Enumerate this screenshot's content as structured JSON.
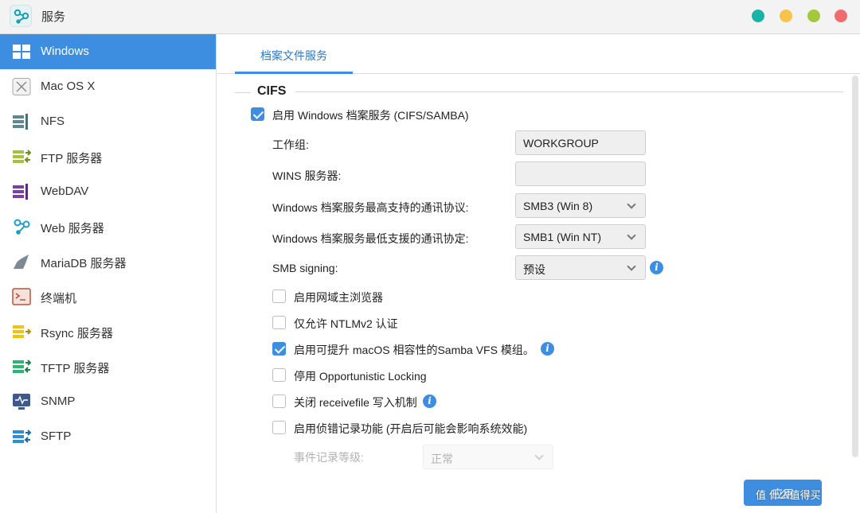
{
  "window": {
    "title": "服务",
    "colors": {
      "accent": "#3d8de0",
      "btn_teal": "#1ab3a8",
      "btn_yellow": "#f8c34a",
      "btn_green": "#a3c83a",
      "btn_red": "#f06b6b"
    }
  },
  "sidebar": {
    "items": [
      {
        "label": "Windows",
        "icon": "windows-icon",
        "active": true
      },
      {
        "label": "Mac OS X",
        "icon": "macos-icon"
      },
      {
        "label": "NFS",
        "icon": "nfs-icon"
      },
      {
        "label": "FTP 服务器",
        "icon": "ftp-icon"
      },
      {
        "label": "WebDAV",
        "icon": "webdav-icon"
      },
      {
        "label": "Web 服务器",
        "icon": "web-server-icon"
      },
      {
        "label": "MariaDB 服务器",
        "icon": "mariadb-icon"
      },
      {
        "label": "终端机",
        "icon": "terminal-icon"
      },
      {
        "label": "Rsync 服务器",
        "icon": "rsync-icon"
      },
      {
        "label": "TFTP 服务器",
        "icon": "tftp-icon"
      },
      {
        "label": "SNMP",
        "icon": "snmp-icon"
      },
      {
        "label": "SFTP",
        "icon": "sftp-icon"
      }
    ]
  },
  "main": {
    "tab": "档案文件服务",
    "section": "CIFS",
    "enable_label": "启用 Windows 档案服务 (CIFS/SAMBA)",
    "fields": {
      "workgroup_label": "工作组:",
      "workgroup_value": "WORKGROUP",
      "wins_label": "WINS 服务器:",
      "wins_value": "",
      "max_proto_label": "Windows 档案服务最高支持的通讯协议:",
      "max_proto_value": "SMB3 (Win 8)",
      "min_proto_label": "Windows 档案服务最低支援的通讯协定:",
      "min_proto_value": "SMB1 (Win NT)",
      "signing_label": "SMB signing:",
      "signing_value": "预设"
    },
    "options": [
      {
        "label": "启用网域主浏览器",
        "checked": false
      },
      {
        "label": "仅允许 NTLMv2 认证",
        "checked": false
      },
      {
        "label": "启用可提升 macOS 相容性的Samba VFS 模组。",
        "checked": true
      },
      {
        "label": "停用 Opportunistic Locking",
        "checked": false
      },
      {
        "label": "关闭 receivefile 写入机制",
        "checked": false
      },
      {
        "label": "启用侦错记录功能 (开启后可能会影响系统效能)",
        "checked": false
      }
    ],
    "log_level_label": "事件记录等级:",
    "log_level_value": "正常",
    "apply_label": "应用",
    "watermark": "值 什么值得买"
  }
}
